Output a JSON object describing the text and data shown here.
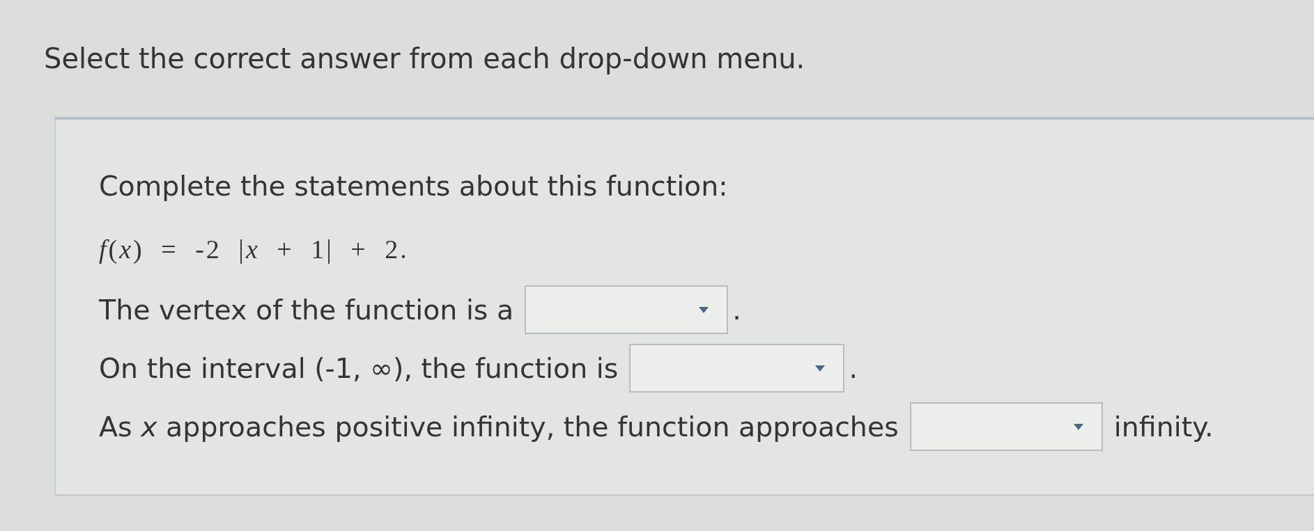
{
  "instruction": "Select the correct answer from each drop-down menu.",
  "question": {
    "prompt": "Complete the statements about this function:",
    "equation": "*f*(*x*) = -2 |*x* + 1| + 2.",
    "statements": [
      {
        "text": "The vertex of the function is a",
        "after": "."
      },
      {
        "text": "On the interval (-1, ∞), the function is",
        "after": "."
      },
      {
        "text": "As *x* approaches positive infinity, the function approaches",
        "after": "infinity."
      }
    ]
  }
}
